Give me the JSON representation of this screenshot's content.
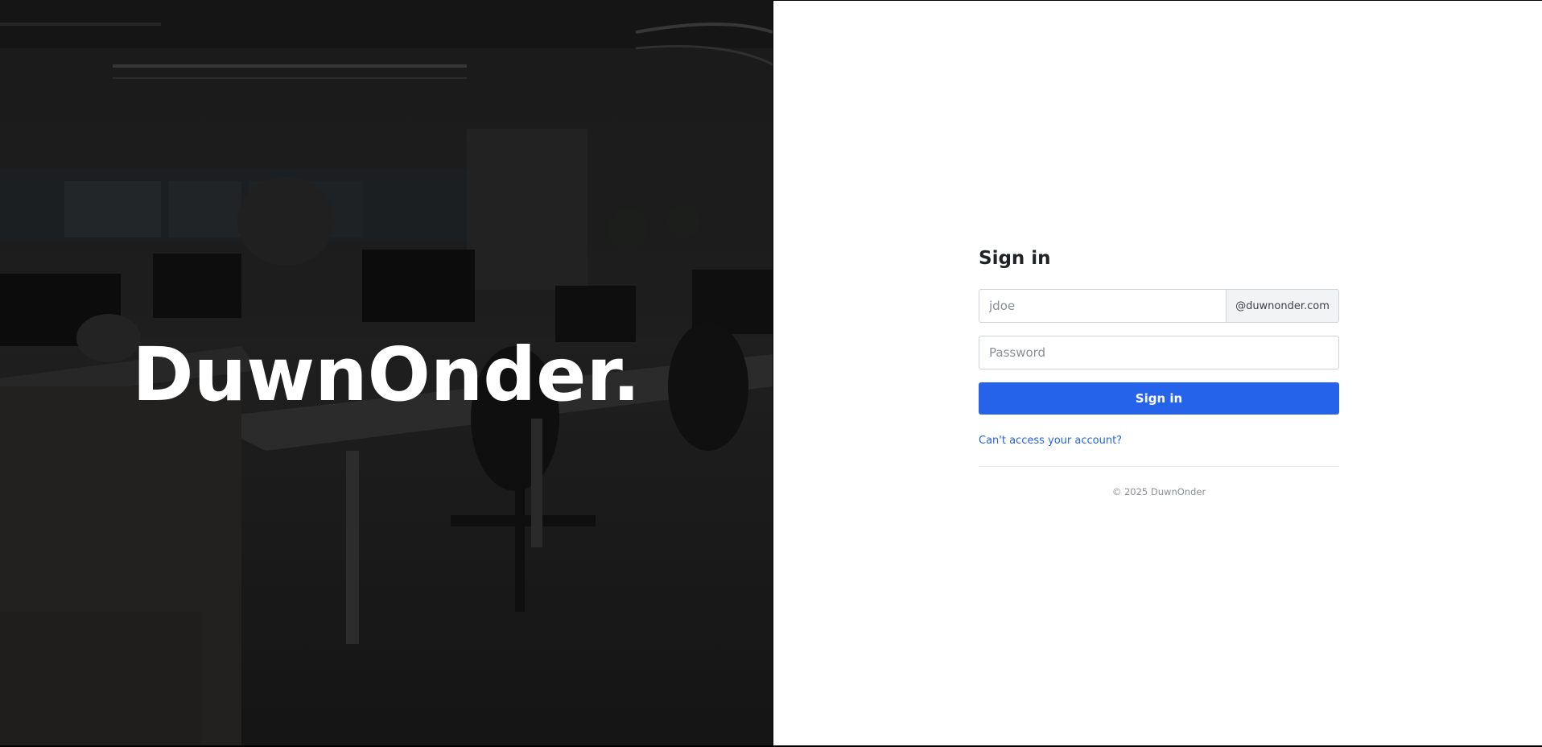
{
  "hero": {
    "brand": "DuwnOnder."
  },
  "login": {
    "title": "Sign in",
    "username_placeholder": "jdoe",
    "username_value": "",
    "domain_suffix": "@duwnonder.com",
    "password_placeholder": "Password",
    "password_value": "",
    "submit_label": "Sign in",
    "help_link": "Can't access your account?",
    "footer": "© 2025 DuwnOnder"
  },
  "colors": {
    "accent": "#2563eb",
    "hero_overlay": "#1e1e1e"
  }
}
